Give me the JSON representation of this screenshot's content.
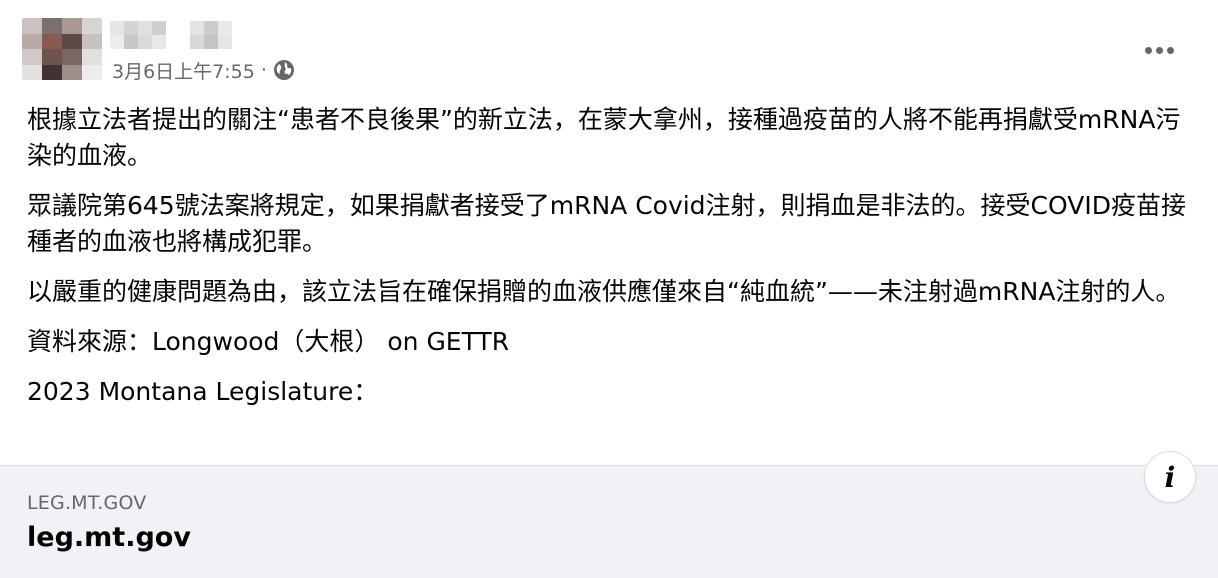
{
  "post": {
    "author_name_hidden": true,
    "timestamp": "3月6日上午7:55",
    "separator": "·",
    "privacy_icon": "globe-icon",
    "more_icon": "more-options-icon",
    "paragraphs": [
      "根據立法者提出的關注“患者不良後果”的新立法，在蒙大拿州，接種過疫苗的人將不能再捐獻受mRNA污染的血液。",
      "眾議院第645號法案將規定，如果捐獻者接受了mRNA Covid注射，則捐血是非法的。接受COVID疫苗接種者的血液也將構成犯罪。",
      "以嚴重的健康問題為由，該立法旨在確保捐贈的血液供應僅來自“純血統”——未注射過mRNA注射的人。",
      "資料來源：Longwood（大根） on GETTR",
      "2023 Montana Legislature："
    ]
  },
  "link_preview": {
    "domain": "LEG.MT.GOV",
    "title": "leg.mt.gov",
    "info_icon": "info-icon",
    "info_glyph": "i"
  },
  "colors": {
    "text_primary": "#050505",
    "text_secondary": "#65676b",
    "link_bg": "#f0f2f5"
  }
}
